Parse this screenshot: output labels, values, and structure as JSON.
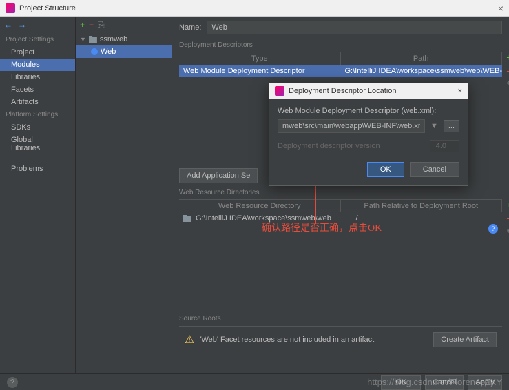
{
  "titlebar": {
    "title": "Project Structure"
  },
  "sidebar": {
    "sections": [
      "Project Settings",
      "Platform Settings"
    ],
    "project_settings": [
      "Project",
      "Modules",
      "Libraries",
      "Facets",
      "Artifacts"
    ],
    "platform_settings": [
      "SDKs",
      "Global Libraries"
    ],
    "problems": "Problems"
  },
  "tree": {
    "root": "ssmweb",
    "child": "Web"
  },
  "content": {
    "name_label": "Name:",
    "name_value": "Web",
    "deploy_section": "Deployment Descriptors",
    "th_type": "Type",
    "th_path": "Path",
    "row_type": "Web Module Deployment Descriptor",
    "row_path": "G:\\IntelliJ IDEA\\workspace\\ssmweb\\web\\WEB-INF\\we",
    "add_app_btn": "Add Application Se",
    "resource_section": "Web Resource Directories",
    "th_dir": "Web Resource Directory",
    "th_rel": "Path Relative to Deployment Root",
    "res_path": "G:\\IntelliJ IDEA\\workspace\\ssmweb\\web",
    "res_rel": "/",
    "source_roots": "Source Roots",
    "warning": "'Web' Facet resources are not included in an artifact",
    "create_artifact": "Create Artifact"
  },
  "dialog": {
    "title": "Deployment Descriptor Location",
    "label": "Web Module Deployment Descriptor (web.xml):",
    "path": "mweb\\src\\main\\webapp\\WEB-INF\\web.xml",
    "version_label": "Deployment descriptor version",
    "version": "4.0",
    "ok": "OK",
    "cancel": "Cancel"
  },
  "annotation": "确认路径是否正确，点击OK",
  "watermark": "https://blog.csdn.net/FlorenceZKY",
  "buttons": {
    "ok": "OK",
    "cancel": "Cancel",
    "apply": "Apply"
  }
}
